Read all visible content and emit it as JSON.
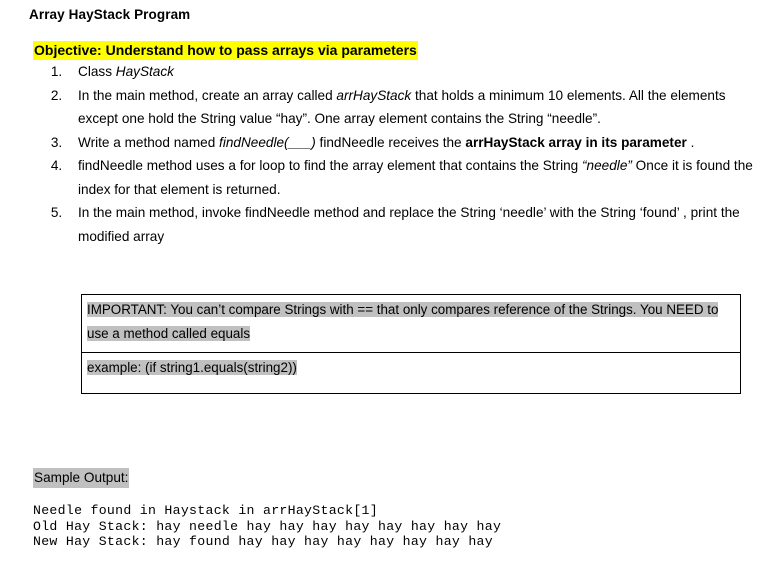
{
  "document": {
    "title": "Array HayStack Program",
    "objective": "Objective: Understand how to pass arrays via parameters",
    "highlight_colors": {
      "objective": "#FFFF00",
      "note": "#C0C0C0",
      "sample_label": "#C0C0C0"
    },
    "tasks": [
      {
        "number": "1.",
        "parts": [
          {
            "text": "Class ",
            "style": "normal"
          },
          {
            "text": "HayStack",
            "style": "italic"
          }
        ]
      },
      {
        "number": "2.",
        "parts": [
          {
            "text": "In the main method, create an array called ",
            "style": "normal"
          },
          {
            "text": "arrHayStack",
            "style": "italic"
          },
          {
            "text": " that holds a minimum 10 elements. All the elements  except one hold the String value “hay”. One array element contains the String “needle”.",
            "style": "normal"
          }
        ]
      },
      {
        "number": "3.",
        "parts": [
          {
            "text": "Write a method named ",
            "style": "normal"
          },
          {
            "text": "findNeedle(___)",
            "style": "italic"
          },
          {
            "text": " findNeedle receives the ",
            "style": "normal"
          },
          {
            "text": "arrHayStack array in its parameter",
            "style": "bold"
          },
          {
            "text": " .",
            "style": "normal"
          }
        ]
      },
      {
        "number": "4.",
        "parts": [
          {
            "text": "findNeedle method uses a for loop to find the array element that contains the String ",
            "style": "normal"
          },
          {
            "text": "“needle”",
            "style": "italic"
          },
          {
            "text": " Once it is found the index for that element is returned.",
            "style": "normal"
          }
        ]
      },
      {
        "number": "5.",
        "parts": [
          {
            "text": "In the main method, invoke findNeedle method and replace the String ‘needle’ with the String ‘found’ , print the modified array",
            "style": "normal"
          }
        ]
      }
    ],
    "note_box": {
      "row1": "IMPORTANT: You can’t compare Strings with == that only compares reference of the Strings. You NEED to use a method called equals",
      "row2": "example: (if string1.equals(string2))"
    },
    "sample_output": {
      "label": "Sample Output:",
      "lines": [
        "Needle found in Haystack in arrHayStack[1]",
        "Old Hay Stack: hay needle hay hay hay hay hay hay hay hay",
        "New Hay Stack: hay found hay hay hay hay hay hay hay hay"
      ]
    }
  }
}
